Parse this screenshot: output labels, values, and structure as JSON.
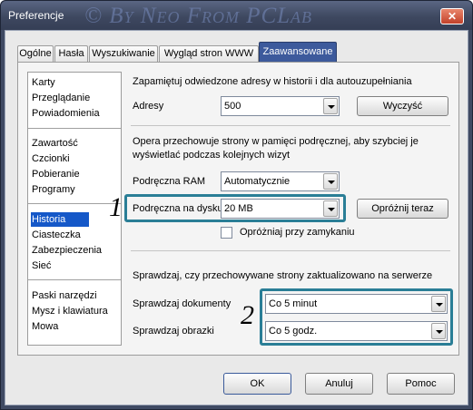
{
  "window": {
    "title": "Preferencje",
    "watermark": "© By Neo From PCLab",
    "close_glyph": "✕"
  },
  "tabs": [
    {
      "label": "Ogólne"
    },
    {
      "label": "Hasła"
    },
    {
      "label": "Wyszukiwanie"
    },
    {
      "label": "Wygląd stron WWW"
    },
    {
      "label": "Zaawansowane",
      "active": true
    }
  ],
  "sidebar": {
    "items": [
      "Karty",
      "Przeglądanie",
      "Powiadomienia",
      "Zawartość",
      "Czcionki",
      "Pobieranie",
      "Programy",
      "Historia",
      "Ciasteczka",
      "Zabezpieczenia",
      "Sieć",
      "Paski narzędzi",
      "Mysz i klawiatura",
      "Mowa"
    ],
    "selected": "Historia"
  },
  "history": {
    "remember_text": "Zapamiętuj odwiedzone adresy w historii i dla autouzupełniania",
    "addresses_label": "Adresy",
    "addresses_value": "500",
    "clear_button": "Wyczyść",
    "cache_info_line1": "Opera przechowuje strony w pamięci podręcznej, aby szybciej je",
    "cache_info_line2": "wyświetlać podczas kolejnych wizyt",
    "ram_cache_label": "Podręczna RAM",
    "ram_cache_value": "Automatycznie",
    "disk_cache_label": "Podręczna na dysku",
    "disk_cache_value": "20 MB",
    "empty_now_button": "Opróżnij teraz",
    "empty_on_exit_label": "Opróżniaj przy zamykaniu",
    "empty_on_exit_checked": false,
    "check_info": "Sprawdzaj, czy przechowywane strony zaktualizowano na serwerze",
    "check_docs_label": "Sprawdzaj dokumenty",
    "check_docs_value": "Co 5 minut",
    "check_images_label": "Sprawdzaj obrazki",
    "check_images_value": "Co 5 godz."
  },
  "annotations": {
    "marker_1": "1",
    "marker_2": "2",
    "highlight_color": "#2a7e96"
  },
  "footer": {
    "ok": "OK",
    "cancel": "Anuluj",
    "help": "Pomoc"
  }
}
